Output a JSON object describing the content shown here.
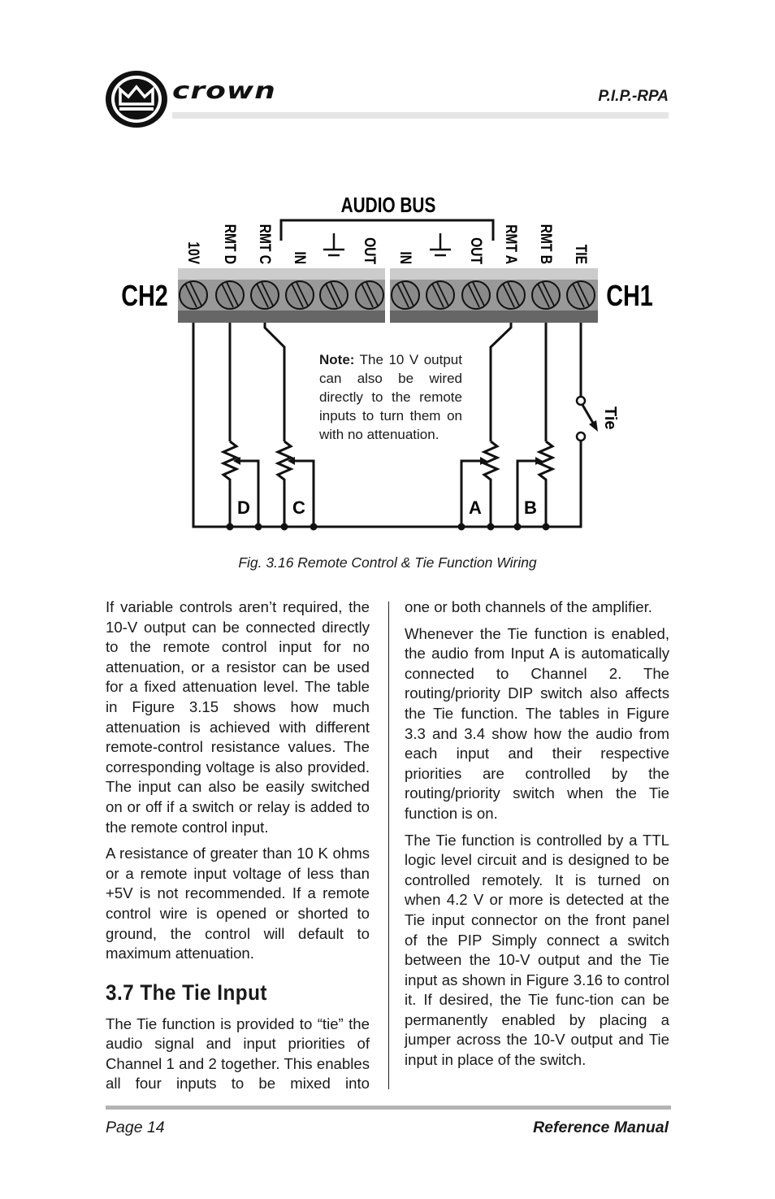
{
  "header": {
    "brand": "crown",
    "doc_code": "P.I.P.-RPA"
  },
  "figure": {
    "bus_label": "AUDIO BUS",
    "ch2_label": "CH2",
    "ch1_label": "CH1",
    "terminals": [
      "10V",
      "RMT D",
      "RMT C",
      "IN",
      "GND",
      "OUT",
      "IN",
      "GND",
      "OUT",
      "RMT A",
      "RMT B",
      "TIE"
    ],
    "pot_labels": [
      "D",
      "C",
      "A",
      "B"
    ],
    "switch_label": "Tie",
    "note_bold": "Note:",
    "note_text": " The 10 V output can also be wired directly to the remote inputs to turn them on with no attenuation.",
    "caption": "Fig. 3.16 Remote Control & Tie Function Wiring",
    "colors": {
      "strip_light": "#cccccc",
      "strip_mid": "#999999",
      "strip_dark": "#666666",
      "screw": "#8a8a8a"
    }
  },
  "body": {
    "left_paragraphs": [
      "If variable controls aren’t required, the 10-V output can be connected directly to the remote control input for no attenuation, or a resistor can be used for a fixed attenuation level. The table in Figure 3.15 shows how much attenuation is achieved with different remote-control resistance values. The corresponding voltage is also provided. The input can also be easily switched on or off if a switch or relay is added to the remote control input.",
      "A resistance of greater than 10 K ohms or a remote input voltage of less than +5V is not recommended. If a remote control wire is opened or shorted to ground, the control will default to maximum attenuation."
    ],
    "section_heading": "3.7 The Tie Input",
    "section_paragraph": "The Tie function is provided to “tie” the audio signal and input priorities of Channel 1 and 2 together. This enables all four inputs to be mixed into",
    "right_paragraphs": [
      "one or both channels of the amplifier.",
      "Whenever the Tie function is enabled, the audio from Input A is automatically connected to Channel 2. The routing/priority DIP switch also affects the Tie function. The tables in Figure 3.3 and 3.4 show how the audio from each input and their respective priorities are controlled by the routing/priority switch when the Tie function is on.",
      "The Tie function is controlled by a TTL logic level circuit and is designed to be controlled remotely. It is turned on when 4.2 V or more is detected at the Tie input connector on the front panel of the PIP Simply connect a switch between the 10-V output and the Tie input as shown in Figure 3.16 to control it. If desired, the Tie func-tion can be permanently enabled by placing a jumper across the 10-V output and Tie input in place of the switch."
    ]
  },
  "footer": {
    "page": "Page 14",
    "title": "Reference Manual"
  }
}
